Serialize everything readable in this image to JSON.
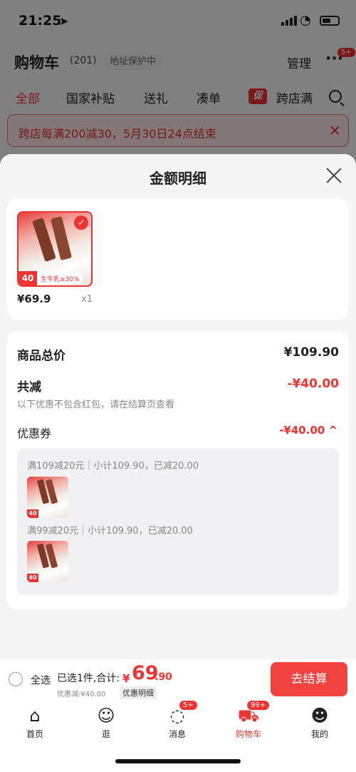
{
  "status": {
    "time": "21:25"
  },
  "header": {
    "title": "购物车",
    "count": "(201)",
    "address": "地址保护中",
    "manage": "管理",
    "more_badge": "5+"
  },
  "tabs": [
    "全部",
    "国家补贴",
    "送礼",
    "凑单",
    "跨店满"
  ],
  "tab_promo_icon": "促",
  "banner": {
    "text": "跨店每满200减30，5月30日24点结束"
  },
  "sheet": {
    "title": "金额明细",
    "item": {
      "price": "¥69.9",
      "qty": "x1",
      "tag": "40",
      "tag_text": "生牛乳≥30%"
    },
    "total_label": "商品总价",
    "total_value": "¥109.90",
    "reduce_label": "共减",
    "reduce_value": "-¥40.00",
    "note": "以下优惠不包含红包，请在结算页查看",
    "coupon_label": "优惠券",
    "coupon_value": "-¥40.00",
    "coupon_lines": [
      "满109减20元｜小计109.90，已减20.00",
      "满99减20元｜小计109.90，已减20.00"
    ]
  },
  "checkout": {
    "select_all": "全选",
    "selected_info": "已选1件,合计:",
    "currency": "¥",
    "amount_int": "69",
    "amount_dec": ".90",
    "discount": "优惠减:¥40.00",
    "detail": "优惠明细",
    "pay": "去结算"
  },
  "tabbar": {
    "items": [
      {
        "label": "首页",
        "icon": "home-icon"
      },
      {
        "label": "逛",
        "icon": "face-icon"
      },
      {
        "label": "消息",
        "icon": "message-icon",
        "badge": "5+"
      },
      {
        "label": "购物车",
        "icon": "cart-icon",
        "badge": "99+"
      },
      {
        "label": "我的",
        "icon": "user-icon"
      }
    ]
  },
  "colors": {
    "accent": "#e33333",
    "pay": "#f0433f"
  }
}
